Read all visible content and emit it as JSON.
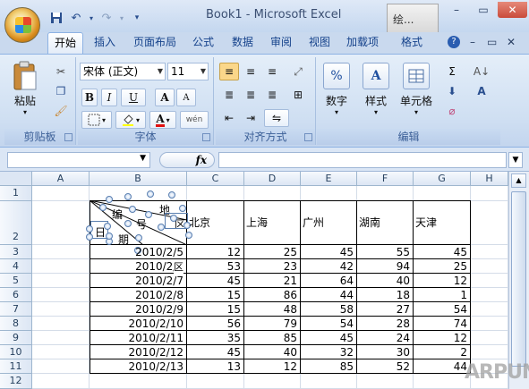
{
  "app": {
    "title": "Book1 - Microsoft Excel",
    "context_tab": "绘...",
    "window_controls": {
      "minimize": "–",
      "restore": "▭",
      "close": "✕"
    }
  },
  "qat": {
    "save_icon": "save-icon",
    "undo_icon": "undo-icon",
    "redo_icon": "redo-icon",
    "more_icon": "dropdown-icon"
  },
  "tabs": [
    {
      "label": "开始",
      "active": true
    },
    {
      "label": "插入"
    },
    {
      "label": "页面布局"
    },
    {
      "label": "公式"
    },
    {
      "label": "数据"
    },
    {
      "label": "审阅"
    },
    {
      "label": "视图"
    },
    {
      "label": "加载项"
    },
    {
      "label": "格式"
    }
  ],
  "tab_right_controls": {
    "help": "?",
    "minimize": "–",
    "restore": "▭",
    "close": "✕"
  },
  "ribbon": {
    "clipboard": {
      "label": "剪贴板",
      "paste": "粘贴"
    },
    "font": {
      "label": "字体",
      "font_name": "宋体 (正文)",
      "font_size": "11",
      "bold": "B",
      "italic": "I",
      "underline": "U",
      "grow": "A",
      "shrink": "A",
      "font_color_letter": "A",
      "wen": "wén",
      "border_icon": "border-icon",
      "fill_icon": "fill-color-icon"
    },
    "alignment": {
      "label": "对齐方式"
    },
    "number": {
      "label": "数字",
      "icon_text": "%"
    },
    "styles": {
      "label": "样式",
      "icon_text": "A"
    },
    "cells": {
      "label": "单元格"
    },
    "editing": {
      "label": "编辑",
      "sum": "Σ",
      "sort": "A↓",
      "find": "A",
      "clear": "⌀"
    }
  },
  "formula_bar": {
    "fx": "fx",
    "name_value": "",
    "formula_value": ""
  },
  "sheet": {
    "columns": [
      "A",
      "B",
      "C",
      "D",
      "E",
      "F",
      "G",
      "H"
    ],
    "rows": [
      "1",
      "2",
      "3",
      "4",
      "5",
      "6",
      "7",
      "8",
      "9",
      "10",
      "11",
      "12"
    ],
    "header_diagonal": {
      "bian": "编",
      "hao": "号",
      "di": "地",
      "qu": "区",
      "ri": "日",
      "qi": "期"
    },
    "header_cities": [
      "北京",
      "上海",
      "广州",
      "湖南",
      "天津"
    ],
    "data": [
      {
        "date": "2010/2/5",
        "values": [
          "12",
          "25",
          "45",
          "55",
          "45"
        ]
      },
      {
        "date": "2010/2/6",
        "values": [
          "53",
          "23",
          "42",
          "94",
          "25"
        ]
      },
      {
        "date": "2010/2/7",
        "values": [
          "45",
          "21",
          "64",
          "40",
          "12"
        ]
      },
      {
        "date": "2010/2/8",
        "values": [
          "15",
          "86",
          "44",
          "18",
          "1"
        ]
      },
      {
        "date": "2010/2/9",
        "values": [
          "15",
          "48",
          "58",
          "27",
          "54"
        ]
      },
      {
        "date": "2010/2/10",
        "values": [
          "56",
          "79",
          "54",
          "28",
          "74"
        ]
      },
      {
        "date": "2010/2/11",
        "values": [
          "35",
          "85",
          "45",
          "24",
          "12"
        ]
      },
      {
        "date": "2010/2/12",
        "values": [
          "45",
          "40",
          "32",
          "30",
          "2"
        ]
      },
      {
        "date": "2010/2/13",
        "values": [
          "13",
          "12",
          "85",
          "52",
          "44"
        ]
      }
    ],
    "date_overlay_char": "区"
  },
  "watermark": "ARPUN"
}
